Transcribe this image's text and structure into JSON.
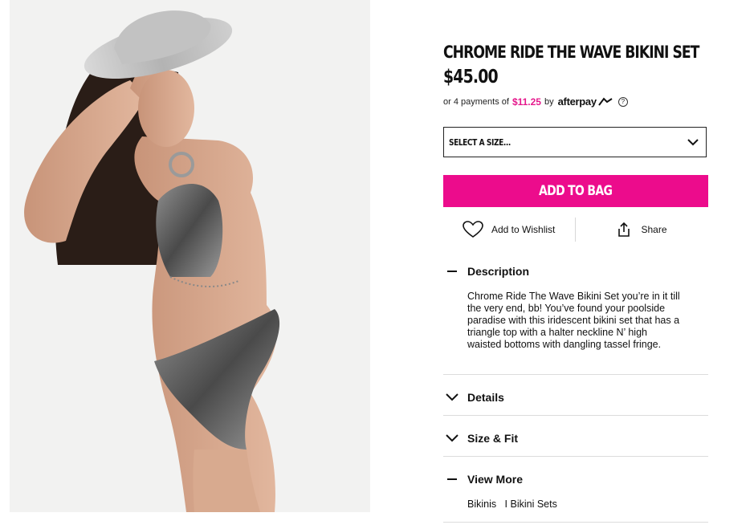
{
  "product": {
    "title": "CHROME RIDE THE WAVE BIKINI SET",
    "price": "$45.00",
    "afterpay": {
      "prefix": "or 4 payments of",
      "amount": "$11.25",
      "by": "by",
      "brand": "afterpay",
      "help": "?"
    }
  },
  "size_select": {
    "label": "SELECT A SIZE...",
    "icon": "chevron-down-icon"
  },
  "add_to_bag": {
    "label": "ADD TO BAG",
    "color": "#ec0c8c"
  },
  "actions": {
    "wishlist": {
      "label": "Add to Wishlist",
      "icon": "heart-icon"
    },
    "share": {
      "label": "Share",
      "icon": "share-icon"
    }
  },
  "accordion": {
    "description": {
      "title": "Description",
      "state": "expanded",
      "text": "Chrome Ride The Wave Bikini Set you’re in it till the very end, bb! You’ve found your poolside paradise with this iridescent bikini set that has a triangle top with a halter neckline N’ high waisted bottoms with dangling tassel fringe."
    },
    "details": {
      "title": "Details",
      "state": "collapsed"
    },
    "size_fit": {
      "title": "Size & Fit",
      "state": "collapsed"
    },
    "view_more": {
      "title": "View More",
      "state": "expanded",
      "links": "Bikinis   I Bikini Sets"
    }
  },
  "image": {
    "alt": "Model wearing chrome bikini set and silver cowboy hat"
  }
}
